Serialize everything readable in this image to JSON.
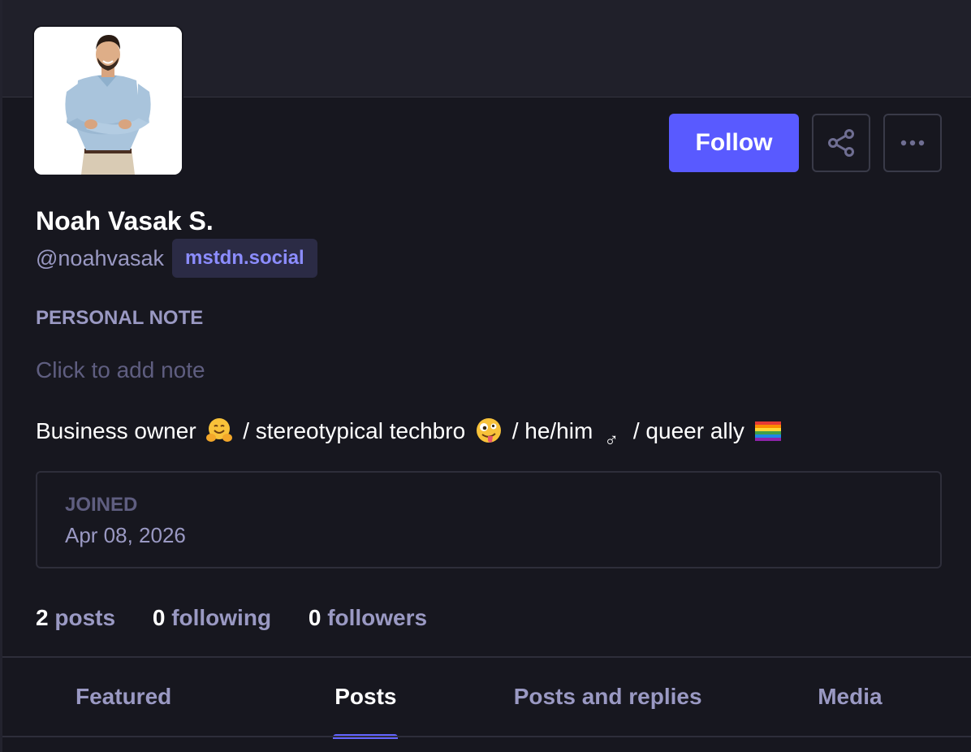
{
  "profile": {
    "display_name": "Noah Vasak S.",
    "username": "@noahvasak",
    "domain": "mstdn.social",
    "avatar_alt": "Profile photo of a man in a light blue shirt with crossed arms"
  },
  "actions": {
    "follow_label": "Follow",
    "share_icon": "share-icon",
    "more_icon": "more-icon"
  },
  "note": {
    "label": "PERSONAL NOTE",
    "placeholder": "Click to add note"
  },
  "bio": {
    "part1": "Business owner",
    "part2": "/ stereotypical techbro",
    "part3": "/ he/him",
    "male_symbol": "♂",
    "part4": "/ queer ally",
    "emojis": [
      "hugging-face-emoji",
      "zany-face-emoji",
      "rainbow-flag-emoji"
    ]
  },
  "joined": {
    "label": "JOINED",
    "date": "Apr 08, 2026"
  },
  "counts": {
    "posts_num": "2",
    "posts_label": "posts",
    "following_num": "0",
    "following_label": "following",
    "followers_num": "0",
    "followers_label": "followers"
  },
  "tabs": [
    {
      "label": "Featured",
      "active": false
    },
    {
      "label": "Posts",
      "active": true
    },
    {
      "label": "Posts and replies",
      "active": false
    },
    {
      "label": "Media",
      "active": false
    }
  ],
  "colors": {
    "background": "#17171f",
    "accent": "#595aff",
    "muted_text": "#9a99c3",
    "faint_text": "#5f5e80"
  }
}
